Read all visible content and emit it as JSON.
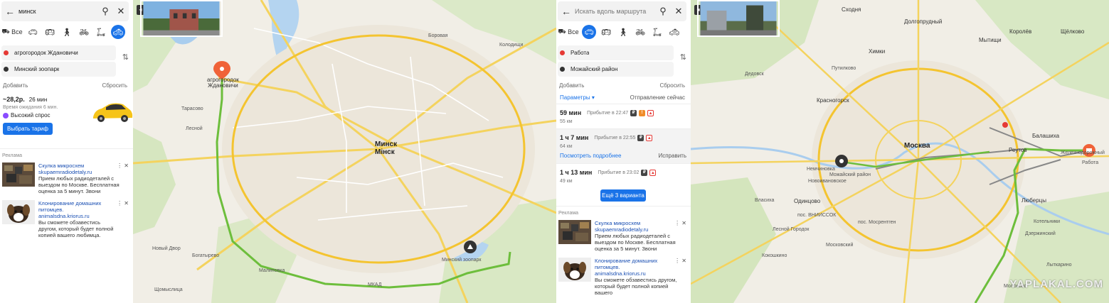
{
  "left_panel": {
    "search_query": "минск",
    "modes_all_label": "Все",
    "from": "агрогородок Ждановичи",
    "to": "Минский зоопарк",
    "add_label": "Добавить",
    "reset_label": "Сбросить",
    "taxi": {
      "price": "~28,2р.",
      "duration": "26 мин",
      "wait": "Время ожидания 6 мин.",
      "demand": "Высокий спрос",
      "button": "Выбрать тариф"
    },
    "ads_label": "Реклама",
    "ads": [
      {
        "title": "Скулка микросхем",
        "url": "skupaemradiodetaly.ru",
        "text": "Прием любых радиодеталей с выездом по Москве. Бесплатная оценка за 5 минут. Звони"
      },
      {
        "title": "Клонирование домашних питомцев.",
        "url": "animalsdna.kriorus.ru",
        "text": "Вы сможете обзавестись другом, который будет полной копией вашего любимца."
      }
    ]
  },
  "map1": {
    "labels": {
      "ag": "агрогородок",
      "zh": "Ждановичи",
      "minsk1": "Минск",
      "minsk2": "Мінск",
      "zoo": "Минский зоопарк",
      "tarasovo": "Тарасово",
      "lesnoy": "Лесной",
      "boraviyaya": "Боровая",
      "novy_dvor": "Новый Двор",
      "bogatyrevo": "Богатырево",
      "shchomyslitsa": "Щомыслица",
      "mkad": "МКАД",
      "malinovka": "Малиновка",
      "kolodishchi": "Колодищи"
    }
  },
  "right_panel": {
    "search_placeholder": "Искать вдоль маршрута",
    "modes_all_label": "Все",
    "from": "Работа",
    "to": "Можайский район",
    "add_label": "Добавить",
    "reset_label": "Сбросить",
    "params_label": "Параметры ▾",
    "depart_label": "Отправление сейчас",
    "routes": [
      {
        "time": "59 мин",
        "arrival": "Прибытие в 22:47",
        "km": "55 км"
      },
      {
        "time": "1 ч 7 мин",
        "arrival": "Прибытие в 22:55",
        "km": "64 км",
        "details": "Посмотреть подробнее",
        "fix": "Исправить"
      },
      {
        "time": "1 ч 13 мин",
        "arrival": "Прибытие в 23:02",
        "km": "49 км"
      }
    ],
    "more_button": "Ещё 3 варианта",
    "ads_label": "Реклама",
    "ads": [
      {
        "title": "Скулка микросхем",
        "url": "skupaemradiodetaly.ru",
        "text": "Прием любых радиодеталей с выездом по Москве. Бесплатная оценка за 5 минут. Звони"
      },
      {
        "title": "Клонирование домашних питомцев.",
        "url": "animalsdna.kriorus.ru",
        "text": "Вы сможете обзавестись другом, который будет полной копией вашего"
      }
    ]
  },
  "map2": {
    "labels": {
      "moskva": "Москва",
      "khimki": "Химки",
      "krasnogorsk": "Красногорск",
      "odintsovo": "Одинцово",
      "reutov": "Реутов",
      "lyubertsy": "Люберцы",
      "balashikha": "Балашиха",
      "mytishchi": "Мытищи",
      "korolev": "Королёв",
      "shchelkovo": "Щёлково",
      "dolgoprudny": "Долгопрудный",
      "skhodnya": "Сходня",
      "zheleznodorozhny": "Железнодорожный",
      "rabota": "Работа",
      "nemchinovka": "Немчиновка",
      "mozhaisky": "Можайский район",
      "novoivankovo": "Новоивановское",
      "vlasikha": "Власиха",
      "kokoshkino": "Кокошкино",
      "moskovsky": "Московский",
      "kotelniki": "Котельники",
      "dzerzhinsky": "Дзержинский",
      "lesnoy_gorodok": "Лесной Городок",
      "vnukovo": "пос. ВНИИССОК",
      "mosrentgen": "пос. Мосрентген",
      "putilkovo": "Путилково",
      "dedovsk": "Дедовск",
      "lytkarino": "Лыткарино",
      "molokovo": "Молоково"
    },
    "watermark": "YAPLAKAL.COM"
  }
}
